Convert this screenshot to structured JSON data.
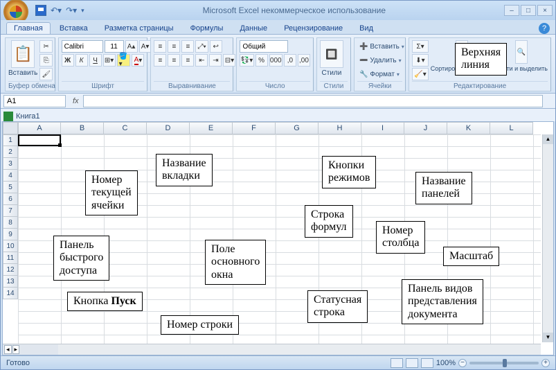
{
  "title": "Microsoft Excel некоммерческое использование",
  "tabs": [
    "Главная",
    "Вставка",
    "Разметка страницы",
    "Формулы",
    "Данные",
    "Рецензирование",
    "Вид"
  ],
  "active_tab": 0,
  "groups": {
    "clipboard": "Буфер обмена",
    "font": "Шрифт",
    "alignment": "Выравнивание",
    "number": "Число",
    "styles": "Стили",
    "cells": "Ячейки",
    "editing": "Редактирование",
    "paste": "Вставить"
  },
  "font": {
    "name": "Calibri",
    "size": "11"
  },
  "number_format": "Общий",
  "cells": {
    "insert": "Вставить",
    "delete": "Удалить",
    "format": "Формат"
  },
  "editing": {
    "sort_filter": "Сортировка и фильтр",
    "find_select": "Найти и выделить"
  },
  "name_box": "A1",
  "workbook": "Книга1",
  "columns": [
    "A",
    "B",
    "C",
    "D",
    "E",
    "F",
    "G",
    "H",
    "I",
    "J",
    "K",
    "L"
  ],
  "rows": [
    "1",
    "2",
    "3",
    "4",
    "5",
    "6",
    "7",
    "8",
    "9",
    "10",
    "11",
    "12",
    "13",
    "14"
  ],
  "status": "Готово",
  "zoom": "100%",
  "callouts": {
    "top_line": "Верхняя\nлиния",
    "tab_name": "Название\nвкладки",
    "modes": "Кнопки\nрежимов",
    "panels": "Название\nпанелей",
    "cur_cell": "Номер\nтекущей\nячейки",
    "qat": "Панель\nбыстрого\nдоступа",
    "office": "Кнопка Пуск",
    "formula": "Строка\nформул",
    "col_num": "Номер\nстолбца",
    "scale": "Масштаб",
    "main_area": "Поле\nосновного\nокна",
    "row_num": "Номер строки",
    "status_cb": "Статусная\nстрока",
    "views": "Панель видов\nпредставления\nдокумента"
  }
}
